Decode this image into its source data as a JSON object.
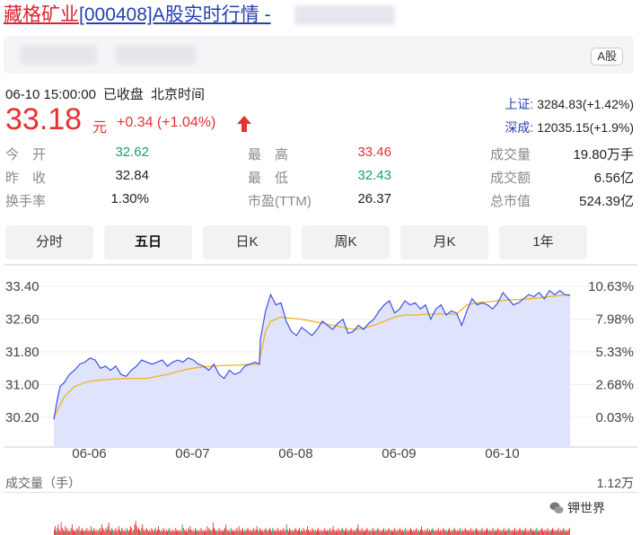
{
  "header": {
    "title_red": "藏格矿业",
    "title_blue": "[000408]A股实时行情 -",
    "badge": "A股"
  },
  "status": {
    "date_time": "06-10 15:00:00",
    "state": "已收盘",
    "timezone": "北京时间"
  },
  "quote": {
    "price": "33.18",
    "unit": "元",
    "change": "+0.34 (+1.04%)",
    "direction_icon": "up-arrow-icon"
  },
  "indices": [
    {
      "name": "上证:",
      "value": "3284.83(+1.42%)"
    },
    {
      "name": "深成:",
      "value": "12035.15(+1.9%)"
    }
  ],
  "stats": [
    [
      {
        "label": "今　开",
        "value": "32.62",
        "tone": "green"
      },
      {
        "label": "最　高",
        "value": "33.46",
        "tone": "red"
      },
      {
        "label": "成交量",
        "value": "19.80万手",
        "tone": ""
      }
    ],
    [
      {
        "label": "昨　收",
        "value": "32.84",
        "tone": ""
      },
      {
        "label": "最　低",
        "value": "32.43",
        "tone": "green"
      },
      {
        "label": "成交额",
        "value": "6.56亿",
        "tone": ""
      }
    ],
    [
      {
        "label": "换手率",
        "value": "1.30%",
        "tone": ""
      },
      {
        "label": "市盈(TTM)",
        "value": "26.37",
        "tone": ""
      },
      {
        "label": "总市值",
        "value": "524.39亿",
        "tone": ""
      }
    ]
  ],
  "tabs": [
    {
      "label": "分时",
      "active": false
    },
    {
      "label": "五日",
      "active": true
    },
    {
      "label": "日K",
      "active": false
    },
    {
      "label": "周K",
      "active": false
    },
    {
      "label": "月K",
      "active": false
    },
    {
      "label": "1年",
      "active": false
    }
  ],
  "volume": {
    "label": "成交量（手）",
    "max": "1.12万"
  },
  "watermark": "钾世界",
  "colors": {
    "up": "#e93030",
    "down": "#15a262",
    "price_line": "#3f51e8",
    "avg_line": "#f0b41c",
    "area_fill": "#dfe3fb"
  },
  "chart_data": {
    "type": "line",
    "title": "",
    "y_ticks_left": [
      "33.40",
      "32.60",
      "31.80",
      "31.00",
      "30.20"
    ],
    "y_ticks_right": [
      "10.63%",
      "7.98%",
      "5.33%",
      "2.68%",
      "0.03%"
    ],
    "x_ticks": [
      "06-06",
      "06-07",
      "06-08",
      "06-09",
      "06-10"
    ],
    "ylim": [
      30.0,
      33.6
    ],
    "x_unit": "trading day index (0-5, each day 0..1)",
    "series": [
      {
        "x": [
          0.0,
          0.03,
          0.06,
          0.1,
          0.15,
          0.2,
          0.25,
          0.3,
          0.35,
          0.4,
          0.45,
          0.5,
          0.55,
          0.6,
          0.65,
          0.7,
          0.75,
          0.8,
          0.85,
          0.9,
          0.95,
          1.0,
          1.05,
          1.1,
          1.15,
          1.2,
          1.25,
          1.3,
          1.35,
          1.4,
          1.45,
          1.5,
          1.55,
          1.6,
          1.65,
          1.7,
          1.75,
          1.8,
          1.85,
          1.9,
          1.95,
          1.99,
          2.0,
          2.05,
          2.1,
          2.15,
          2.2,
          2.25,
          2.3,
          2.35,
          2.4,
          2.45,
          2.5,
          2.55,
          2.6,
          2.65,
          2.7,
          2.75,
          2.8,
          2.85,
          2.9,
          2.95,
          3.0,
          3.05,
          3.1,
          3.15,
          3.2,
          3.25,
          3.3,
          3.35,
          3.4,
          3.45,
          3.5,
          3.55,
          3.6,
          3.65,
          3.7,
          3.75,
          3.8,
          3.85,
          3.9,
          3.95,
          4.0,
          4.05,
          4.1,
          4.15,
          4.2,
          4.25,
          4.3,
          4.35,
          4.4,
          4.45,
          4.5,
          4.55,
          4.6,
          4.65,
          4.7,
          4.75,
          4.8,
          4.85,
          4.9,
          4.95,
          5.0
        ],
        "y": [
          30.15,
          30.6,
          30.95,
          31.05,
          31.25,
          31.35,
          31.5,
          31.55,
          31.65,
          31.6,
          31.4,
          31.45,
          31.35,
          31.45,
          31.25,
          31.2,
          31.35,
          31.45,
          31.6,
          31.55,
          31.5,
          31.55,
          31.6,
          31.45,
          31.55,
          31.6,
          31.55,
          31.65,
          31.6,
          31.5,
          31.45,
          31.35,
          31.5,
          31.25,
          31.15,
          31.35,
          31.25,
          31.3,
          31.45,
          31.5,
          31.55,
          31.5,
          32.1,
          32.8,
          33.2,
          32.95,
          33.0,
          32.55,
          32.3,
          32.2,
          32.4,
          32.3,
          32.2,
          32.35,
          32.55,
          32.45,
          32.35,
          32.5,
          32.6,
          32.25,
          32.3,
          32.45,
          32.35,
          32.5,
          32.6,
          32.8,
          32.95,
          33.05,
          32.75,
          32.85,
          33.05,
          32.95,
          33.0,
          32.85,
          32.95,
          32.6,
          32.85,
          32.95,
          32.7,
          32.8,
          32.75,
          32.45,
          32.8,
          33.1,
          32.95,
          33.0,
          32.95,
          32.85,
          33.0,
          33.25,
          33.1,
          32.95,
          33.0,
          33.1,
          33.2,
          33.15,
          33.25,
          33.1,
          33.3,
          33.2,
          33.3,
          33.2,
          33.18
        ]
      },
      {
        "x": [
          0.0,
          0.05,
          0.1,
          0.2,
          0.3,
          0.4,
          0.5,
          0.6,
          0.7,
          0.8,
          0.9,
          1.0,
          1.1,
          1.2,
          1.3,
          1.4,
          1.5,
          1.6,
          1.7,
          1.8,
          1.9,
          1.99,
          2.0,
          2.05,
          2.1,
          2.2,
          2.3,
          2.4,
          2.5,
          2.6,
          2.7,
          2.8,
          2.9,
          3.0,
          3.1,
          3.2,
          3.3,
          3.4,
          3.5,
          3.6,
          3.7,
          3.8,
          3.9,
          4.0,
          4.1,
          4.2,
          4.3,
          4.4,
          4.5,
          4.6,
          4.7,
          4.8,
          4.9,
          5.0
        ],
        "y": [
          30.2,
          30.45,
          30.7,
          30.95,
          31.05,
          31.1,
          31.12,
          31.14,
          31.15,
          31.15,
          31.15,
          31.2,
          31.25,
          31.32,
          31.38,
          31.42,
          31.44,
          31.46,
          31.47,
          31.48,
          31.5,
          31.5,
          31.7,
          32.3,
          32.55,
          32.65,
          32.62,
          32.6,
          32.55,
          32.5,
          32.45,
          32.4,
          32.35,
          32.38,
          32.45,
          32.55,
          32.65,
          32.7,
          32.7,
          32.72,
          32.73,
          32.73,
          32.72,
          32.95,
          33.0,
          33.02,
          33.05,
          33.07,
          33.08,
          33.1,
          33.12,
          33.15,
          33.18,
          33.2
        ]
      }
    ]
  },
  "volume_data": [
    0.3,
    0.5,
    0.2,
    0.4,
    0.6,
    0.3,
    0.2,
    0.7,
    0.4,
    0.3,
    0.2,
    0.5,
    0.3,
    0.4,
    0.2,
    0.3,
    0.2,
    0.4,
    0.6,
    0.3,
    0.2,
    0.3,
    0.2,
    0.4,
    0.3,
    0.5,
    0.2,
    0.3,
    0.4,
    0.2,
    0.3,
    0.2,
    0.3,
    0.4,
    0.2,
    0.3,
    0.2,
    0.5,
    0.3,
    0.2,
    0.4,
    0.3,
    0.2,
    0.3,
    0.2,
    0.3,
    0.4,
    0.2,
    0.6,
    0.4,
    0.3,
    0.2,
    0.4,
    0.3,
    0.5,
    0.7,
    0.3,
    0.2,
    0.4,
    0.3,
    0.2,
    0.3,
    0.4,
    0.2,
    0.3,
    0.5,
    0.3,
    0.2,
    0.4,
    0.3,
    0.2,
    0.3,
    0.2,
    0.4,
    0.3,
    0.2,
    0.3,
    0.5,
    0.4,
    0.2,
    0.3,
    0.6,
    0.8,
    0.5,
    0.3,
    0.4,
    0.3,
    0.2,
    0.4,
    0.6,
    0.3,
    0.2,
    0.3,
    0.4,
    0.3,
    0.2,
    0.3,
    0.2,
    0.4,
    0.3,
    0.2,
    0.3,
    0.4,
    0.2,
    0.3,
    0.5,
    0.3,
    0.2,
    0.3,
    0.2,
    0.4,
    0.3,
    0.2,
    0.3,
    0.2,
    0.3,
    0.4,
    0.2,
    0.3,
    0.2,
    0.3,
    0.2,
    0.4,
    0.3,
    0.2,
    0.3,
    0.2,
    0.3,
    0.2,
    0.6,
    0.4,
    0.3,
    0.2,
    0.3,
    0.2,
    0.4,
    0.3,
    0.5,
    0.3,
    0.2,
    0.3,
    0.2,
    0.4,
    0.3,
    0.2,
    0.3,
    0.2,
    0.3,
    0.4,
    0.2,
    0.3,
    0.2,
    0.3,
    0.2,
    0.5,
    0.3,
    0.4,
    0.3,
    0.2,
    0.3,
    0.7,
    0.4,
    0.3,
    0.2,
    0.3,
    0.2,
    0.4,
    0.3,
    0.2,
    0.3,
    0.2,
    0.3,
    0.4,
    0.6,
    0.3,
    0.2,
    0.3,
    0.2,
    0.4,
    0.3,
    0.2,
    0.3,
    0.2,
    0.3,
    0.4,
    0.2,
    0.5,
    0.3,
    0.2,
    0.3,
    0.4,
    0.2,
    0.3,
    0.2,
    0.3,
    0.4,
    0.3,
    0.2,
    0.3,
    0.2,
    0.3,
    0.4,
    0.2,
    0.3,
    0.5,
    0.3,
    0.2,
    0.4,
    0.3,
    0.2,
    0.3,
    0.2,
    0.3,
    0.4,
    0.3,
    0.2,
    0.3,
    0.4,
    0.3,
    0.2,
    0.4,
    0.3,
    0.2,
    0.3,
    0.2,
    0.4,
    0.3,
    0.2,
    0.3,
    0.2,
    0.3,
    0.4,
    0.2,
    0.3,
    0.6,
    0.3,
    0.2,
    0.4,
    0.3,
    0.2,
    0.3,
    0.2,
    0.3,
    0.4,
    0.3,
    0.2,
    0.3,
    0.4,
    0.2,
    0.3,
    0.2,
    0.4,
    0.3,
    0.2,
    0.3,
    0.5,
    0.3,
    0.2,
    0.3,
    0.2,
    0.4,
    0.3,
    0.2,
    0.3,
    0.2,
    0.3,
    0.4,
    0.2,
    0.3,
    0.2,
    0.3,
    0.2,
    0.4,
    0.3,
    0.2,
    0.3,
    0.2,
    0.3,
    0.4,
    0.2,
    0.3,
    0.5,
    0.3,
    0.2,
    0.3,
    0.2,
    0.4,
    0.3,
    0.2,
    0.3,
    0.4,
    0.3,
    0.2,
    0.3,
    0.4,
    0.2,
    0.3,
    0.2,
    0.3,
    0.4,
    0.3,
    0.2,
    0.3,
    0.2,
    0.3,
    0.4,
    0.6,
    0.3,
    0.2,
    0.3,
    0.4,
    0.2,
    0.3,
    0.2,
    0.3,
    0.4,
    0.3,
    0.2,
    0.3,
    0.2,
    0.3,
    0.4,
    0.2,
    0.3,
    0.2,
    0.3,
    0.4,
    0.3,
    0.2,
    0.3,
    0.2,
    0.3,
    0.4,
    0.2,
    0.3,
    0.2,
    0.3,
    0.4,
    0.3,
    0.2,
    0.3,
    0.2,
    0.3,
    0.4,
    0.2,
    0.3,
    0.2,
    0.3,
    0.4,
    0.3,
    0.2,
    0.3,
    0.2,
    0.3,
    0.4,
    0.2,
    0.3,
    0.2,
    0.3,
    0.4,
    0.3,
    0.2,
    0.3,
    0.2,
    0.3,
    0.4,
    0.2,
    0.3,
    0.2,
    0.3,
    0.5,
    0.3,
    0.2,
    0.3,
    0.2,
    0.3,
    0.4,
    0.2,
    0.3,
    0.2,
    0.3,
    0.4,
    0.3,
    0.2,
    0.3,
    0.2,
    0.3,
    0.4,
    0.2,
    0.3,
    0.2,
    0.3,
    0.4,
    0.3,
    0.2,
    0.3,
    0.2,
    0.3,
    0.4,
    0.2,
    0.3,
    0.2,
    0.3,
    0.4,
    0.3,
    0.2,
    0.3,
    0.2,
    0.3,
    0.4,
    0.2,
    0.3,
    0.2,
    0.3,
    0.4,
    0.3,
    0.2,
    0.3,
    0.2,
    0.3,
    0.4,
    0.2,
    0.3,
    0.2,
    0.3,
    0.4,
    0.3,
    0.2,
    0.3,
    0.2,
    0.3,
    0.4,
    0.2,
    0.3,
    0.2,
    0.3,
    0.4,
    0.3,
    0.2,
    0.3,
    0.2,
    0.3,
    0.4,
    0.2,
    0.3,
    0.2,
    0.3,
    0.4,
    0.3,
    0.2,
    0.3,
    0.2,
    0.3,
    0.4,
    0.2,
    0.3,
    0.2,
    0.3,
    0.4,
    0.3,
    0.2,
    0.3,
    0.2,
    0.3,
    0.4,
    0.2,
    0.3,
    0.2,
    0.3,
    0.4,
    0.3,
    0.2,
    0.3,
    0.2,
    0.3,
    0.4,
    0.2,
    0.3,
    0.2,
    0.3,
    0.4,
    0.3,
    0.2,
    0.3,
    0.2,
    0.3,
    0.4,
    0.2,
    0.3,
    0.2,
    0.3,
    0.4,
    0.3,
    0.2,
    0.3,
    0.2,
    0.3,
    0.4,
    0.2,
    0.3,
    0.2,
    0.3,
    0.4,
    0.3,
    0.2,
    0.3,
    0.2,
    0.3,
    0.4,
    0.2,
    0.3,
    0.2,
    0.3,
    0.4,
    0.3,
    0.2,
    0.3,
    0.2,
    0.3,
    0.4
  ]
}
